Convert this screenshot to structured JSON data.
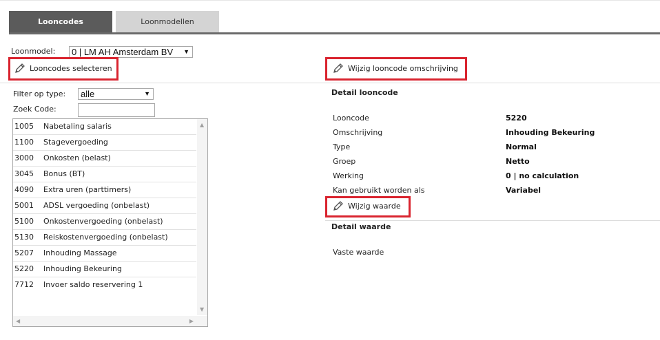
{
  "tabs": [
    {
      "label": "Looncodes",
      "active": true
    },
    {
      "label": "Loonmodellen",
      "active": false
    }
  ],
  "loonmodel": {
    "label": "Loonmodel:",
    "value": "0 | LM AH Amsterdam BV"
  },
  "actions": {
    "select_codes": "Looncodes selecteren",
    "edit_description": "Wijzig looncode omschrijving",
    "edit_value": "Wijzig waarde"
  },
  "filter": {
    "label": "Filter op type:",
    "value": "alle"
  },
  "search": {
    "label": "Zoek Code:",
    "value": ""
  },
  "codes": [
    {
      "code": "1005",
      "desc": "Nabetaling salaris"
    },
    {
      "code": "1100",
      "desc": "Stagevergoeding"
    },
    {
      "code": "3000",
      "desc": "Onkosten (belast)"
    },
    {
      "code": "3045",
      "desc": "Bonus (BT)"
    },
    {
      "code": "4090",
      "desc": "Extra uren (parttimers)"
    },
    {
      "code": "5001",
      "desc": "ADSL vergoeding (onbelast)"
    },
    {
      "code": "5100",
      "desc": "Onkostenvergoeding (onbelast)"
    },
    {
      "code": "5130",
      "desc": "Reiskostenvergoeding (onbelast)"
    },
    {
      "code": "5207",
      "desc": "Inhouding Massage"
    },
    {
      "code": "5220",
      "desc": "Inhouding Bekeuring"
    },
    {
      "code": "7712",
      "desc": "Invoer saldo reservering 1"
    }
  ],
  "detail": {
    "title": "Detail looncode",
    "rows": [
      {
        "label": "Looncode",
        "value": "5220"
      },
      {
        "label": "Omschrijving",
        "value": "Inhouding Bekeuring"
      },
      {
        "label": "Type",
        "value": "Normal"
      },
      {
        "label": "Groep",
        "value": "Netto"
      },
      {
        "label": "Werking",
        "value": "0 | no calculation"
      },
      {
        "label": "Kan gebruikt worden als",
        "value": "Variabel"
      }
    ]
  },
  "detail_value": {
    "title": "Detail waarde",
    "label": "Vaste waarde"
  },
  "colors": {
    "highlight": "#d9232e",
    "tab_active": "#5b5b5b",
    "tab_inactive": "#d4d4d4"
  },
  "icons": {
    "edit": "pencil-icon",
    "dropdown": "triangle-down",
    "scroll_up": "triangle-up"
  }
}
